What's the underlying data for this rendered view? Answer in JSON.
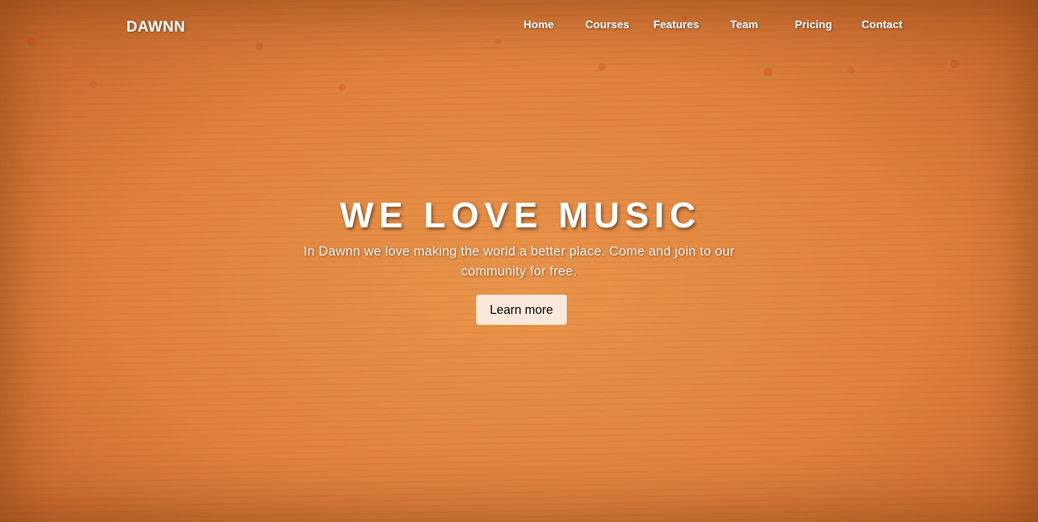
{
  "navbar": {
    "brand": "DAWNN",
    "links": [
      {
        "label": "Home"
      },
      {
        "label": "Courses"
      },
      {
        "label": "Features"
      },
      {
        "label": "Team"
      },
      {
        "label": "Pricing"
      },
      {
        "label": "Contact"
      }
    ]
  },
  "hero": {
    "title": "WE LOVE MUSIC",
    "text": "In Dawnn we love making the world a better place. Come and join to our community for free.",
    "button_label": "Learn more"
  },
  "colors": {
    "background": "#db8440",
    "text": "#ffffff",
    "button_background": "#fbe8dc",
    "button_text": "#000000"
  }
}
